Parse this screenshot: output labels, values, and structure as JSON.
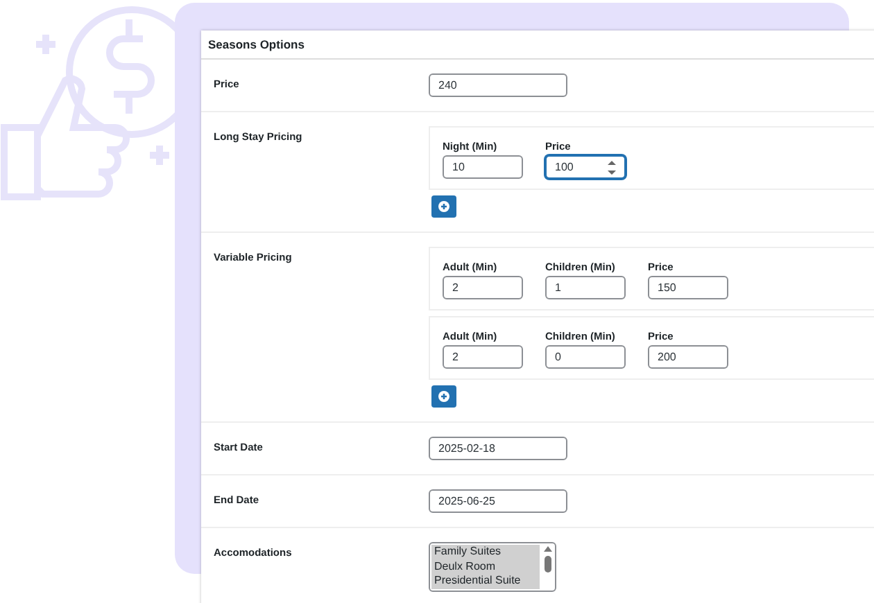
{
  "header": {
    "title": "Seasons Options"
  },
  "rows": [
    {
      "kind": "text",
      "label": "Price",
      "value": "240"
    },
    {
      "kind": "group",
      "label": "Long Stay Pricing",
      "groups": [
        {
          "fields": [
            {
              "label": "Night (Min)",
              "value": "10",
              "focused": false
            },
            {
              "label": "Price",
              "value": "100",
              "focused": true
            }
          ]
        }
      ]
    },
    {
      "kind": "group",
      "label": "Variable Pricing",
      "groups": [
        {
          "fields": [
            {
              "label": "Adult (Min)",
              "value": "2",
              "focused": false
            },
            {
              "label": "Children (Min)",
              "value": "1",
              "focused": false
            },
            {
              "label": "Price",
              "value": "150",
              "focused": false
            }
          ]
        },
        {
          "fields": [
            {
              "label": "Adult (Min)",
              "value": "2",
              "focused": false
            },
            {
              "label": "Children (Min)",
              "value": "0",
              "focused": false
            },
            {
              "label": "Price",
              "value": "200",
              "focused": false
            }
          ]
        }
      ]
    },
    {
      "kind": "text",
      "label": "Start Date",
      "value": "2025-02-18"
    },
    {
      "kind": "text",
      "label": "End Date",
      "value": "2025-06-25"
    },
    {
      "kind": "list",
      "label": "Accomodations",
      "options": [
        {
          "label": "Family Suites",
          "selected": true
        },
        {
          "label": "Deulx Room",
          "selected": true
        },
        {
          "label": "Presidential Suite",
          "selected": true
        }
      ]
    }
  ]
}
